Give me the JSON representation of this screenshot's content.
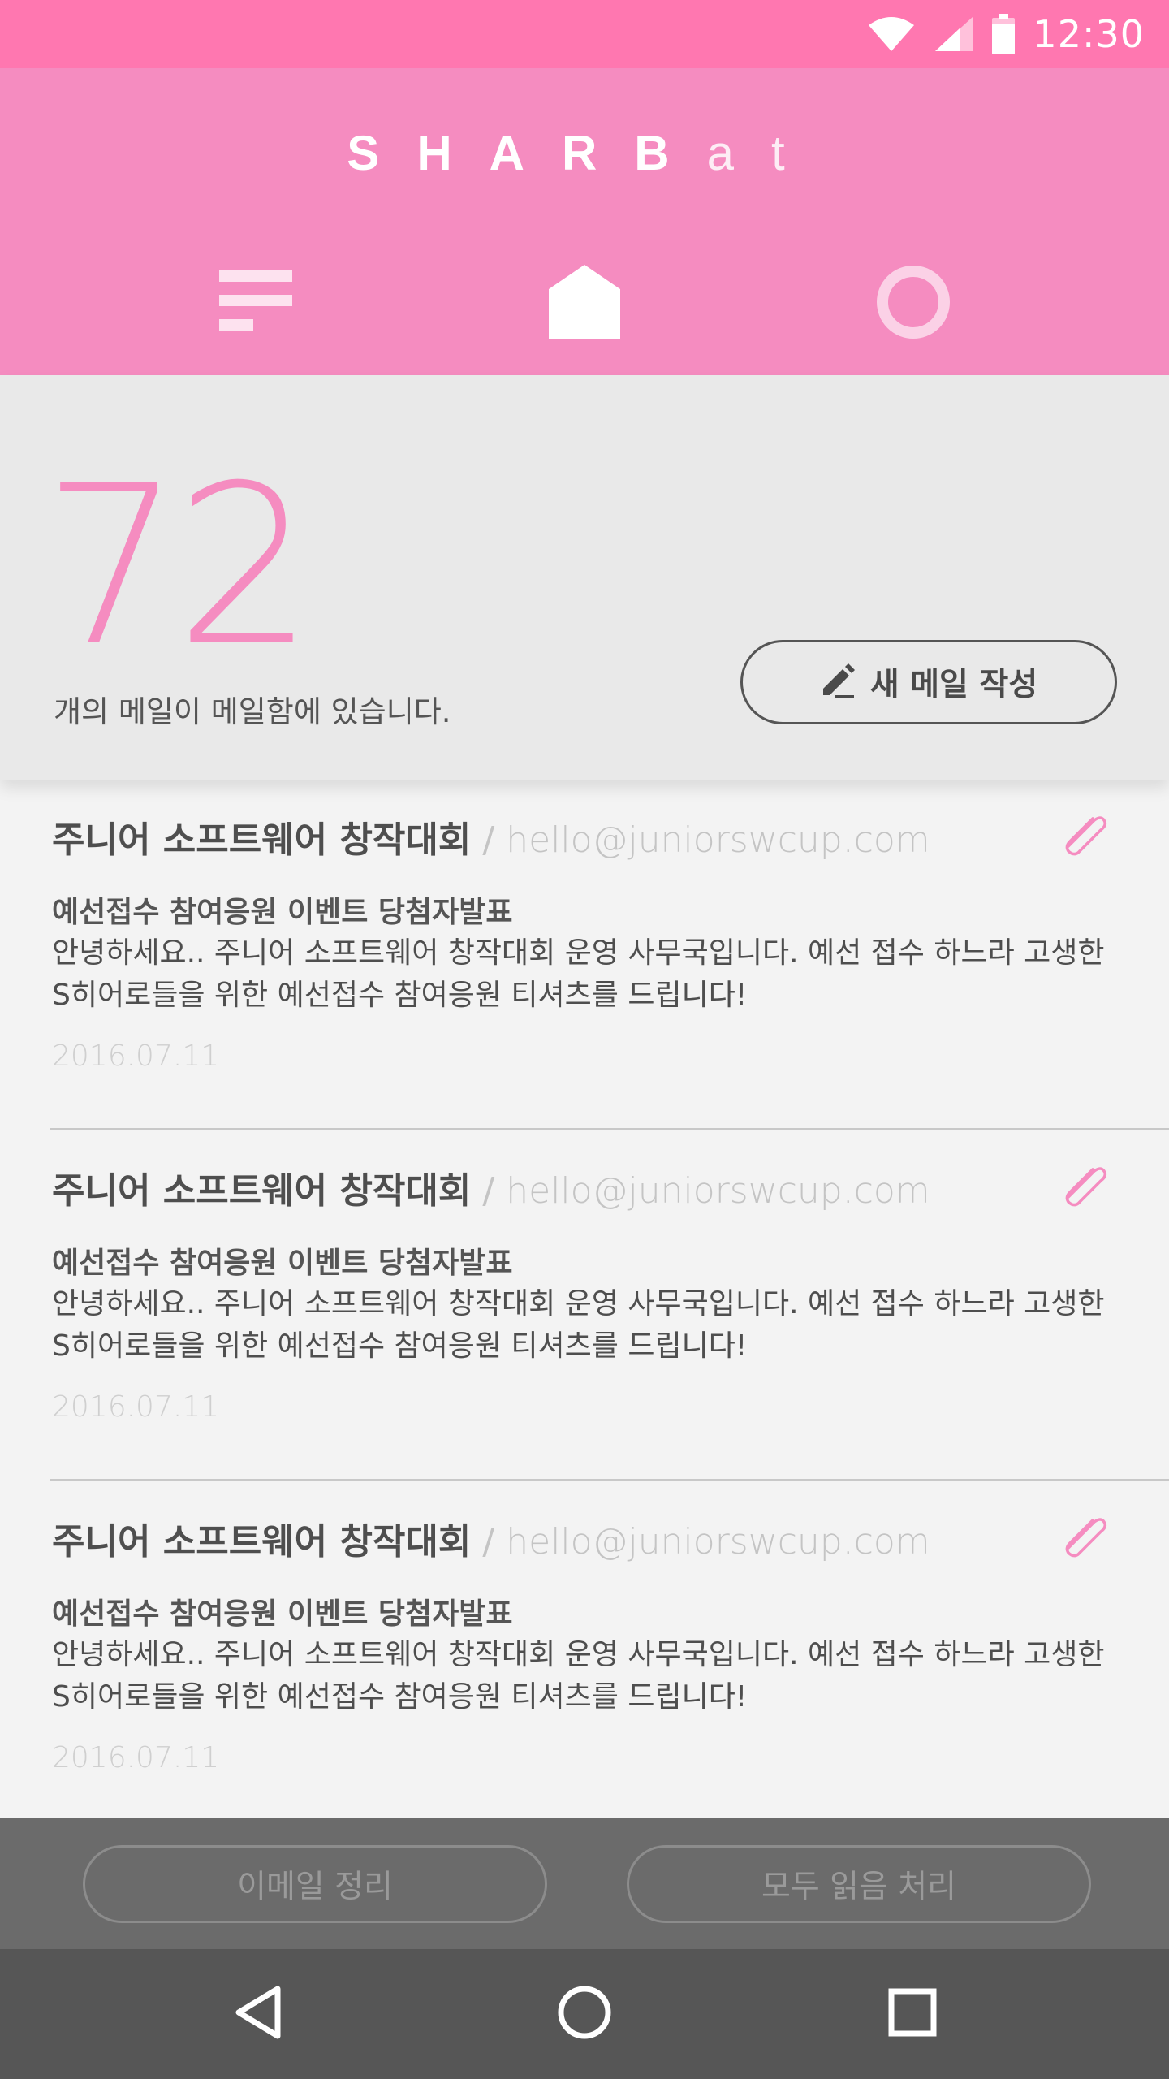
{
  "status_bar": {
    "time": "12:30",
    "icons": [
      "wifi-icon",
      "cell-signal-icon",
      "battery-icon"
    ]
  },
  "header": {
    "brand_primary": "SHARB",
    "brand_secondary": "at",
    "tabs": [
      {
        "name": "menu",
        "icon": "menu-lines-icon",
        "active": false
      },
      {
        "name": "home",
        "icon": "home-icon",
        "active": true
      },
      {
        "name": "profile",
        "icon": "ring-icon",
        "active": false
      }
    ]
  },
  "summary": {
    "count": "72",
    "caption": "개의 메일이 메일함에 있습니다.",
    "compose_label": "새 메일 작성",
    "compose_icon": "pencil-icon"
  },
  "mails": [
    {
      "sender": "주니어 소프트웨어 창작대회",
      "separator": "/",
      "email": "hello@juniorswcup.com",
      "subject": "예선접수 참여응원 이벤트 당첨자발표",
      "preview": "안녕하세요.. 주니어 소프트웨어 창작대회 운영 사무국입니다. 예선 접수 하느라 고생한 S히어로들을 위한 예선접수 참여응원 티셔츠를 드립니다!",
      "date": "2016.07.11",
      "attachment_icon": "paperclip-icon"
    },
    {
      "sender": "주니어 소프트웨어 창작대회",
      "separator": "/",
      "email": "hello@juniorswcup.com",
      "subject": "예선접수 참여응원 이벤트 당첨자발표",
      "preview": "안녕하세요.. 주니어 소프트웨어 창작대회 운영 사무국입니다. 예선 접수 하느라 고생한 S히어로들을 위한 예선접수 참여응원 티셔츠를 드립니다!",
      "date": "2016.07.11",
      "attachment_icon": "paperclip-icon"
    },
    {
      "sender": "주니어 소프트웨어 창작대회",
      "separator": "/",
      "email": "hello@juniorswcup.com",
      "subject": "예선접수 참여응원 이벤트 당첨자발표",
      "preview": "안녕하세요.. 주니어 소프트웨어 창작대회 운영 사무국입니다. 예선 접수 하느라 고생한 S히어로들을 위한 예선접수 참여응원 티셔츠를 드립니다!",
      "date": "2016.07.11",
      "attachment_icon": "paperclip-icon"
    }
  ],
  "actions": {
    "clean_label": "이메일 정리",
    "read_all_label": "모두 읽음 처리"
  },
  "nav_bar": {
    "icons": [
      "back-triangle-icon",
      "home-circle-icon",
      "recents-square-icon"
    ]
  },
  "colors": {
    "status_bar": "#ff77b0",
    "header": "#f58cc0",
    "accent": "#f58cc0",
    "summary_bg": "#e9e9e9",
    "list_bg": "#f3f3f3",
    "action_bar": "#6b6b6b",
    "nav_bar": "#565656"
  }
}
